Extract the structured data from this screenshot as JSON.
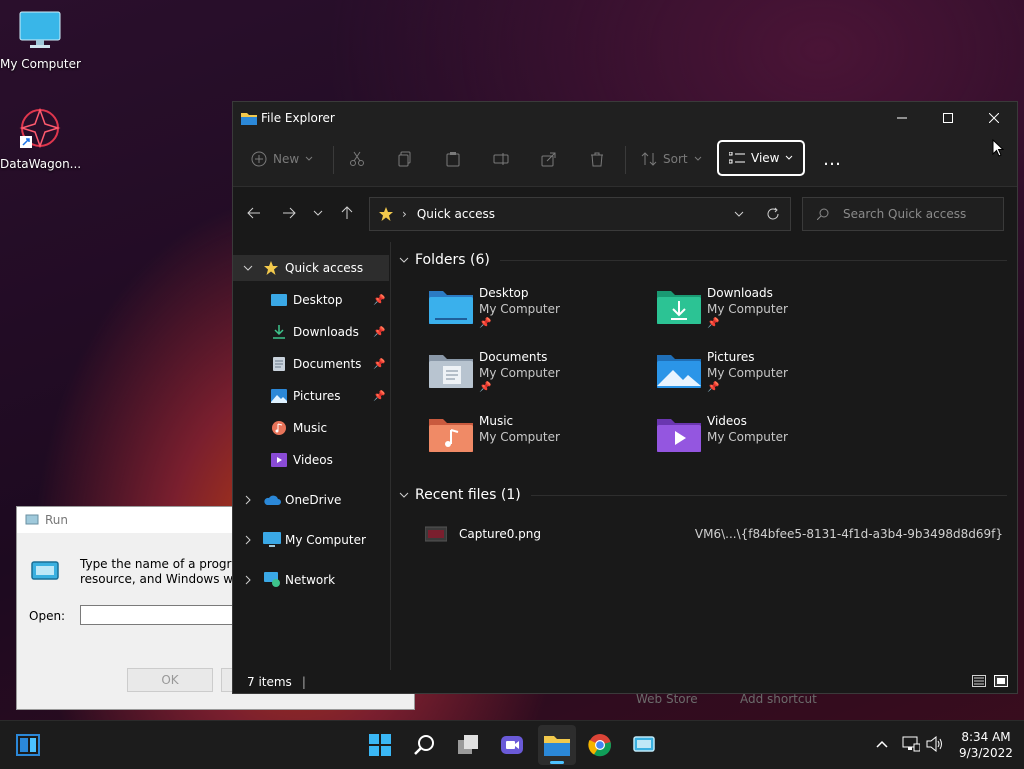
{
  "desktop": {
    "icons": [
      {
        "label": "My Computer",
        "icon": "monitor-icon"
      },
      {
        "label": "DataWagon...",
        "icon": "datawagon-shortcut-icon"
      }
    ],
    "background_behind_text": [
      "Web Store",
      "Add shortcut"
    ]
  },
  "run_dialog": {
    "title": "Run",
    "description_line1": "Type the name of a program,",
    "description_line2": "resource, and Windows will o",
    "open_label": "Open:",
    "open_value": "",
    "ok_label": "OK"
  },
  "explorer": {
    "title": "File Explorer",
    "toolbar": {
      "new_label": "New",
      "sort_label": "Sort",
      "view_label": "View",
      "more_label": "…"
    },
    "address": {
      "path_root": "Quick access",
      "search_placeholder": "Search Quick access"
    },
    "nav": {
      "quick_access": "Quick access",
      "items": [
        {
          "label": "Desktop",
          "pinned": true
        },
        {
          "label": "Downloads",
          "pinned": true
        },
        {
          "label": "Documents",
          "pinned": true
        },
        {
          "label": "Pictures",
          "pinned": true
        },
        {
          "label": "Music",
          "pinned": false
        },
        {
          "label": "Videos",
          "pinned": false
        }
      ],
      "onedrive": "OneDrive",
      "my_computer": "My Computer",
      "network": "Network"
    },
    "folders_header": "Folders (6)",
    "folders": [
      {
        "name": "Desktop",
        "location": "My Computer",
        "pinned": true
      },
      {
        "name": "Downloads",
        "location": "My Computer",
        "pinned": true
      },
      {
        "name": "Documents",
        "location": "My Computer",
        "pinned": true
      },
      {
        "name": "Pictures",
        "location": "My Computer",
        "pinned": true
      },
      {
        "name": "Music",
        "location": "My Computer",
        "pinned": false
      },
      {
        "name": "Videos",
        "location": "My Computer",
        "pinned": false
      }
    ],
    "recent_header": "Recent files (1)",
    "recent_files": [
      {
        "name": "Capture0.png",
        "path": "VM6\\...\\{f84bfee5-8131-4f1d-a3b4-9b3498d8d69f}"
      }
    ],
    "status": {
      "items": "7 items"
    }
  },
  "taskbar": {
    "time": "8:34 AM",
    "date": "9/3/2022"
  },
  "colors": {
    "accent_blue": "#2b88d8",
    "folder_yellow": "#f2c94c",
    "window_bg": "#191919"
  }
}
